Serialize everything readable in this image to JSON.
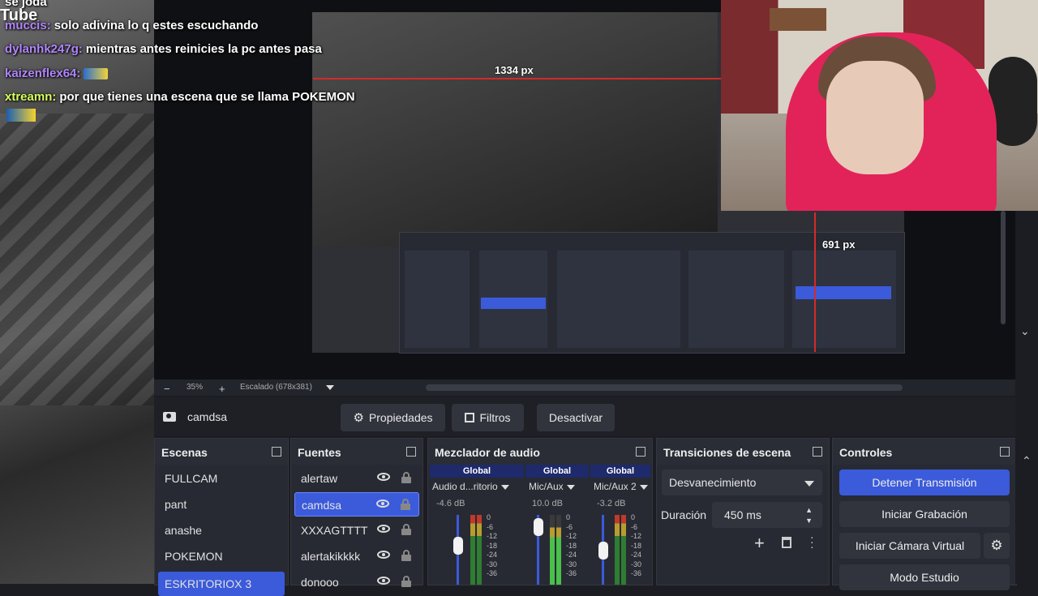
{
  "chat": {
    "line0": {
      "user": "",
      "msg": "se joda"
    },
    "line1": {
      "user": "muccis:",
      "user_color": "#b286ff",
      "msg": "solo adivina lo q estes escuchando"
    },
    "line2": {
      "user": "dylanhk247g:",
      "user_color": "#b286ff",
      "msg": "mientras antes reinicies la pc antes pasa"
    },
    "line3": {
      "user": "kaizenflex64:",
      "user_color": "#b286ff",
      "msg": ""
    },
    "line4": {
      "user": "xtreamn:",
      "user_color": "#d7ff5a",
      "msg": "por que tienes una escena que se llama POKEMON"
    }
  },
  "overlay_logo": "Tube",
  "preview": {
    "width_readout": "1334 px",
    "height_readout": "691 px"
  },
  "zoom": {
    "minus": "−",
    "value": "35%",
    "plus": "+",
    "scale_label": "Escalado (678x381)"
  },
  "source_bar": {
    "source_name": "camdsa",
    "properties": "Propiedades",
    "filters": "Filtros",
    "deactivate": "Desactivar"
  },
  "scenes": {
    "title": "Escenas",
    "items": [
      "FULLCAM",
      "pant",
      "anashe",
      "POKEMON",
      "ESKRITORIOX 3"
    ],
    "selected_index": 4
  },
  "sources": {
    "title": "Fuentes",
    "items": [
      "alertaw",
      "camdsa",
      "XXXAGTTTT",
      "alertakikkkk",
      "donooo"
    ],
    "selected_index": 1
  },
  "mixer": {
    "title": "Mezclador de audio",
    "channels": [
      {
        "group": "Global",
        "name": "Audio d...ritorio",
        "db": "-4.6 dB",
        "level": 0.62
      },
      {
        "group": "Global",
        "name": "Mic/Aux",
        "db": "10.0 dB",
        "level": 0.88
      },
      {
        "group": "Global",
        "name": "Mic/Aux 2",
        "db": "-3.2 dB",
        "level": 0.55
      }
    ],
    "scale": [
      "0",
      "-6",
      "-12",
      "-18",
      "-24",
      "-30",
      "-36"
    ]
  },
  "transitions": {
    "title": "Transiciones de escena",
    "selected": "Desvanecimiento",
    "duration_label": "Duración",
    "duration_value": "450 ms"
  },
  "controls": {
    "title": "Controles",
    "stop_stream": "Detener Transmisión",
    "start_recording": "Iniciar Grabación",
    "start_virtual_cam": "Iniciar Cámara Virtual",
    "studio_mode": "Modo Estudio"
  },
  "colors": {
    "accent": "#3b5bdb",
    "panel": "#272a33",
    "guide_red": "#d42a2a"
  }
}
